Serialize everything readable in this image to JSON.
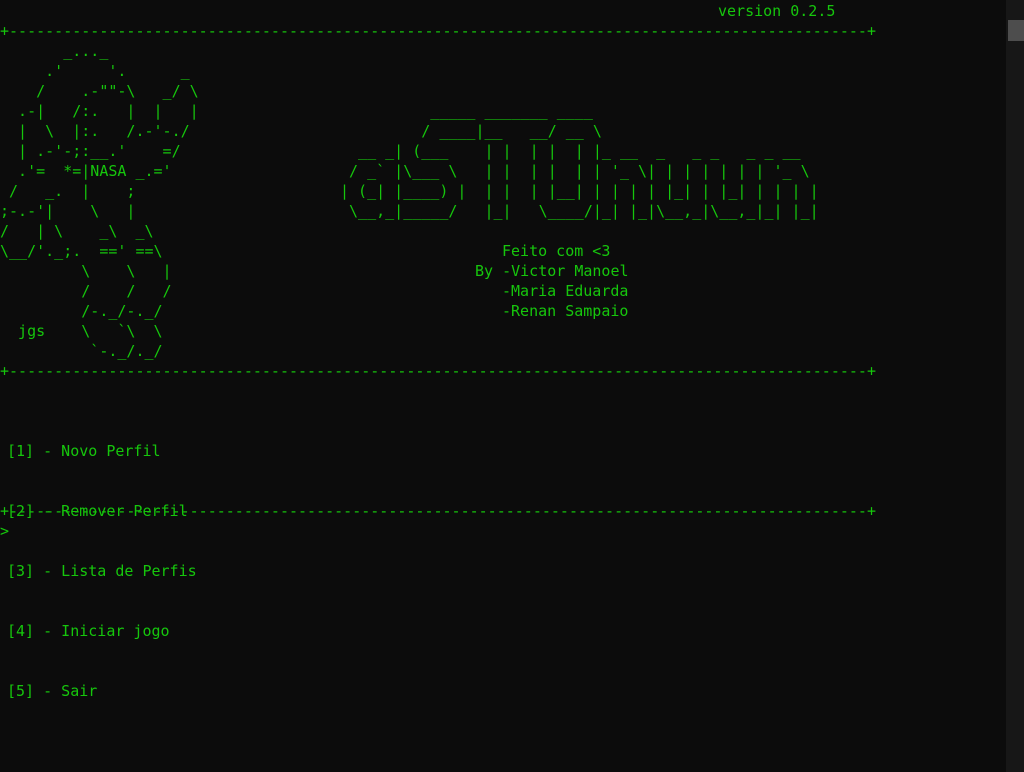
{
  "header": {
    "version": "version 0.2.5"
  },
  "separator": "+-----------------------------------------------------------------------------------------------+",
  "art": {
    "astronaut": "       _..._\n     .'     '.      _\n    /    .-\"\"-\\   _/ \\\n  .-|   /:.   |  |   |\n  |  \\  |:.   /.-'-./\n  | .-'-;:__.'    =/\n  .'=  *=|NASA _.='\n /   _.  |    ;\n;-.-'|    \\   |\n/   | \\    _\\  _\\\n\\__/'._;.  ==' ==\\\n         \\    \\   |\n         /    /   /\n         /-._/-._/\n  jgs    \\   `\\  \\\n          `-._/._/",
    "logo": "          _____ _______ ____\n         / ____|__   __/ __ \\\n  __ _| (___    | |  | |  | |_ __  _   _ _   _ _ __\n / _` |\\___ \\   | |  | |  | | '_ \\| | | | | | | '_ \\\n| (_| |____) |  | |  | |__| | | | | |_| | |_| | | | |\n \\__,_|_____/   |_|   \\____/|_| |_|\\__,_|\\__,_|_| |_|"
  },
  "credits": {
    "made_with": "Feito com <3",
    "author1": "By -Victor Manoel",
    "author2": "-Maria Eduarda",
    "author3": "-Renan Sampaio"
  },
  "menu": {
    "items": [
      "[1] - Novo Perfil",
      "[2] - Remover Perfil",
      "[3] - Lista de Perfis",
      "[4] - Iniciar jogo",
      "[5] - Sair"
    ]
  },
  "prompt": {
    "symbol": ">"
  },
  "colors": {
    "text": "#16c60c",
    "background": "#0c0c0c"
  }
}
